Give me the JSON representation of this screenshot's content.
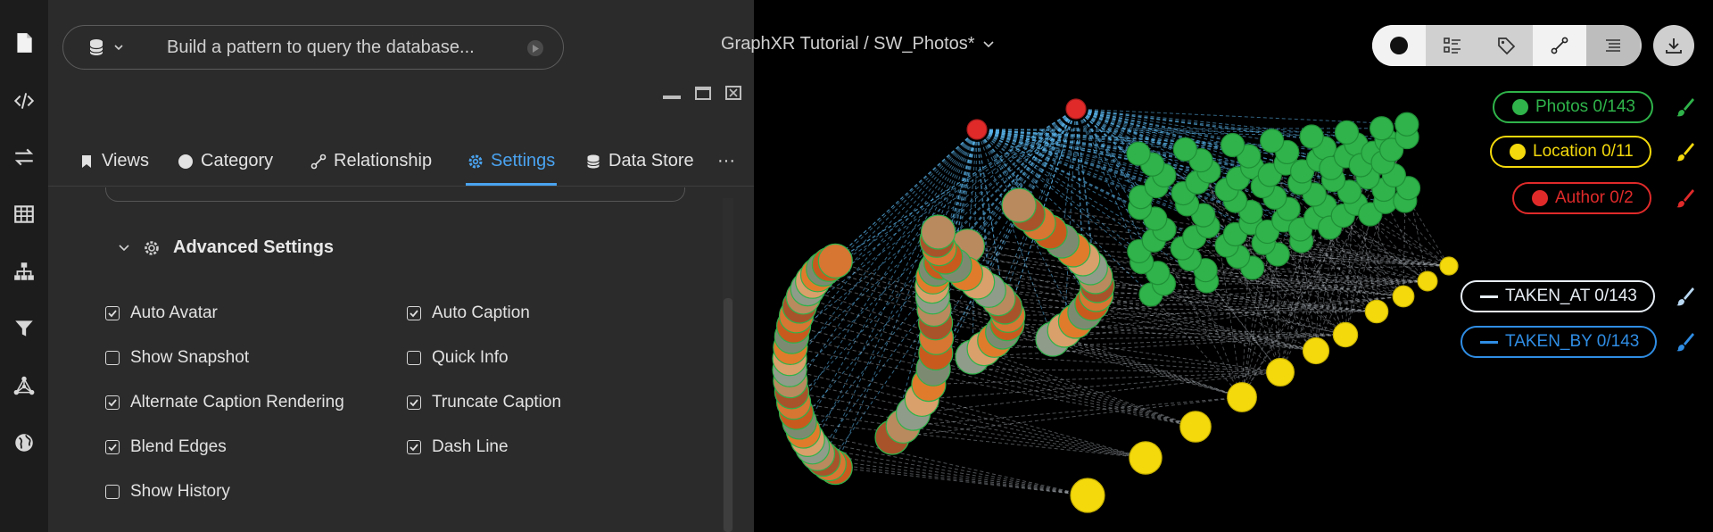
{
  "query": {
    "placeholder": "Build a pattern to query the database..."
  },
  "graph_title": "GraphXR Tutorial / SW_Photos*",
  "tabs": [
    {
      "label": "Views"
    },
    {
      "label": "Category"
    },
    {
      "label": "Relationship"
    },
    {
      "label": "Settings"
    },
    {
      "label": "Data Store"
    }
  ],
  "more_tabs": "···",
  "advanced_settings": {
    "title": "Advanced Settings"
  },
  "options_left": [
    {
      "label": "Auto Avatar",
      "checked": true
    },
    {
      "label": "Show Snapshot",
      "checked": false
    },
    {
      "label": "Alternate Caption Rendering",
      "checked": true
    },
    {
      "label": "Blend Edges",
      "checked": true
    },
    {
      "label": "Show History",
      "checked": false
    }
  ],
  "options_right": [
    {
      "label": "Auto Caption",
      "checked": true
    },
    {
      "label": "Quick Info",
      "checked": false
    },
    {
      "label": "Truncate Caption",
      "checked": true
    },
    {
      "label": "Dash Line",
      "checked": true
    }
  ],
  "legend": {
    "photos": {
      "label": "Photos 0/143",
      "color": "#2fb34a"
    },
    "location": {
      "label": "Location 0/11",
      "color": "#f4d90c"
    },
    "author": {
      "label": "Author 0/2",
      "color": "#e02a2a"
    },
    "taken_at": {
      "label": "TAKEN_AT 0/143",
      "color": "#e8eef5"
    },
    "taken_by": {
      "label": "TAKEN_BY 0/143",
      "color": "#2f8de4"
    }
  },
  "colors": {
    "accent": "#4aa3f0",
    "panel_bg": "#2b2b2b",
    "rail_bg": "#1c1c1c",
    "edge_blue": "#5bb8f0",
    "edge_white": "#dfe8f0"
  }
}
